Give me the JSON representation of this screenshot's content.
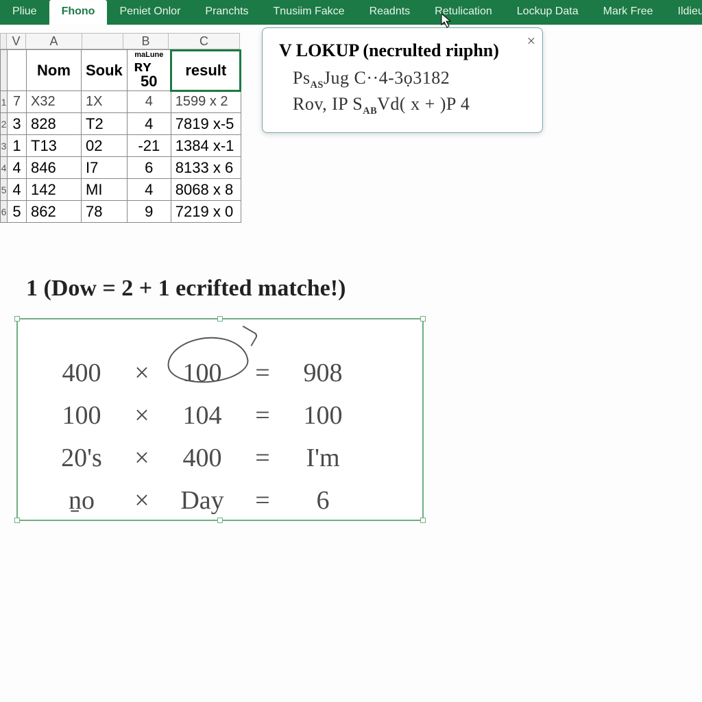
{
  "ribbon": {
    "tabs": [
      {
        "label": "Pliue"
      },
      {
        "label": "Fhono",
        "active": true
      },
      {
        "label": "Peniet Onlor"
      },
      {
        "label": "Pranchts"
      },
      {
        "label": "Tnusiim Fakce"
      },
      {
        "label": "Readnts"
      },
      {
        "label": "Retulication"
      },
      {
        "label": "Lockup Data"
      },
      {
        "label": "Mark Free"
      },
      {
        "label": "Ildieulitis"
      }
    ]
  },
  "columns": {
    "V": "V",
    "A": "A",
    "B": "B",
    "C": "C"
  },
  "sheet": {
    "header": {
      "nom": "Nom",
      "souk": "Souk",
      "mini_top": "maLune",
      "mini_l": "ʀʏ",
      "mini_r": "50",
      "result": "result"
    },
    "rows": [
      {
        "rh": "1",
        "idx": "7",
        "nom": "X32",
        "souk": "1X",
        "b": "4",
        "res": "1599 x 2"
      },
      {
        "rh": "2",
        "idx": "3",
        "nom": "828",
        "souk": "T2",
        "b": "4",
        "res": "7819 x-5"
      },
      {
        "rh": "3",
        "idx": "1",
        "nom": "T13",
        "souk": "02",
        "b": "-21",
        "res": "1384 x-1"
      },
      {
        "rh": "4",
        "idx": "4",
        "nom": "846",
        "souk": "I7",
        "b": "6",
        "res": "8133 x 6"
      },
      {
        "rh": "5",
        "idx": "4",
        "nom": "142",
        "souk": "MI",
        "b": "4",
        "res": "8068 x 8"
      },
      {
        "rh": "6",
        "idx": "5",
        "nom": "862",
        "souk": "78",
        "b": "9",
        "res": "7219 x 0"
      }
    ]
  },
  "tooltip": {
    "title": "V LOKUP (necrulted riıphn)",
    "line1_a": "Ps",
    "line1_sub": "AS",
    "line1_b": "Jug C··4-3ọ3182",
    "line2_a": "Rov, IP S",
    "line2_sub": "AB",
    "line2_b": "Vd( x + )P 4",
    "close": "×"
  },
  "heading": "1 (Dow = 2 + 1 ecrifted matche!)",
  "equations": [
    {
      "a": "400",
      "op": "×",
      "b": "100",
      "eq": "=",
      "r": "908"
    },
    {
      "a": "100",
      "op": "×",
      "b": "104",
      "eq": "=",
      "r": "100"
    },
    {
      "a": "20's",
      "op": "×",
      "b": "400",
      "eq": "=",
      "r": "I'm"
    },
    {
      "a": "n̠o",
      "op": "×",
      "b": "Day",
      "eq": "=",
      "r": "6"
    }
  ]
}
